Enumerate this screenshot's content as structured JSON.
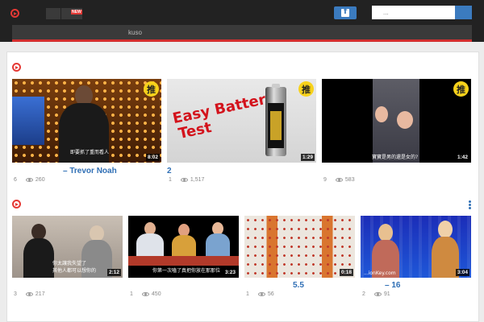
{
  "header": {
    "new_badge": "NEW",
    "search_placeholder": "...",
    "subnav_label": "kuso"
  },
  "sections": [
    {
      "videos": [
        {
          "title": "– Trevor Noah",
          "likes": "6",
          "views": "260",
          "duration": "8:02",
          "badge": "推",
          "subtitle": "即要抓了重而看人"
        },
        {
          "title": "2",
          "likes": "1",
          "views": "1,517",
          "duration": "1:29",
          "badge": "推",
          "thumb_text": [
            "Easy Battery",
            "Test"
          ]
        },
        {
          "title": "",
          "likes": "9",
          "views": "583",
          "duration": "1:42",
          "badge": "推",
          "subtitle": "寶寶是男的還是女的?"
        }
      ]
    },
    {
      "videos": [
        {
          "title": "",
          "likes": "3",
          "views": "217",
          "duration": "2:12",
          "subtitle": "你太讓我失望了",
          "subtitle2": "其他人都可以想你的"
        },
        {
          "title": "",
          "likes": "1",
          "views": "450",
          "duration": "3:23",
          "subtitle": "你第一次嗑了真把你放在那那位"
        },
        {
          "title": "5.5",
          "likes": "1",
          "views": "56",
          "duration": "0:18"
        },
        {
          "title": "– 16",
          "likes": "2",
          "views": "91",
          "duration": "3:04",
          "watermark": "...ionKey.com"
        }
      ]
    }
  ],
  "colors": {
    "accent": "#d32f2f",
    "link": "#2f6fb5",
    "facebook": "#3b7bbf",
    "badge": "#f7d21b"
  }
}
